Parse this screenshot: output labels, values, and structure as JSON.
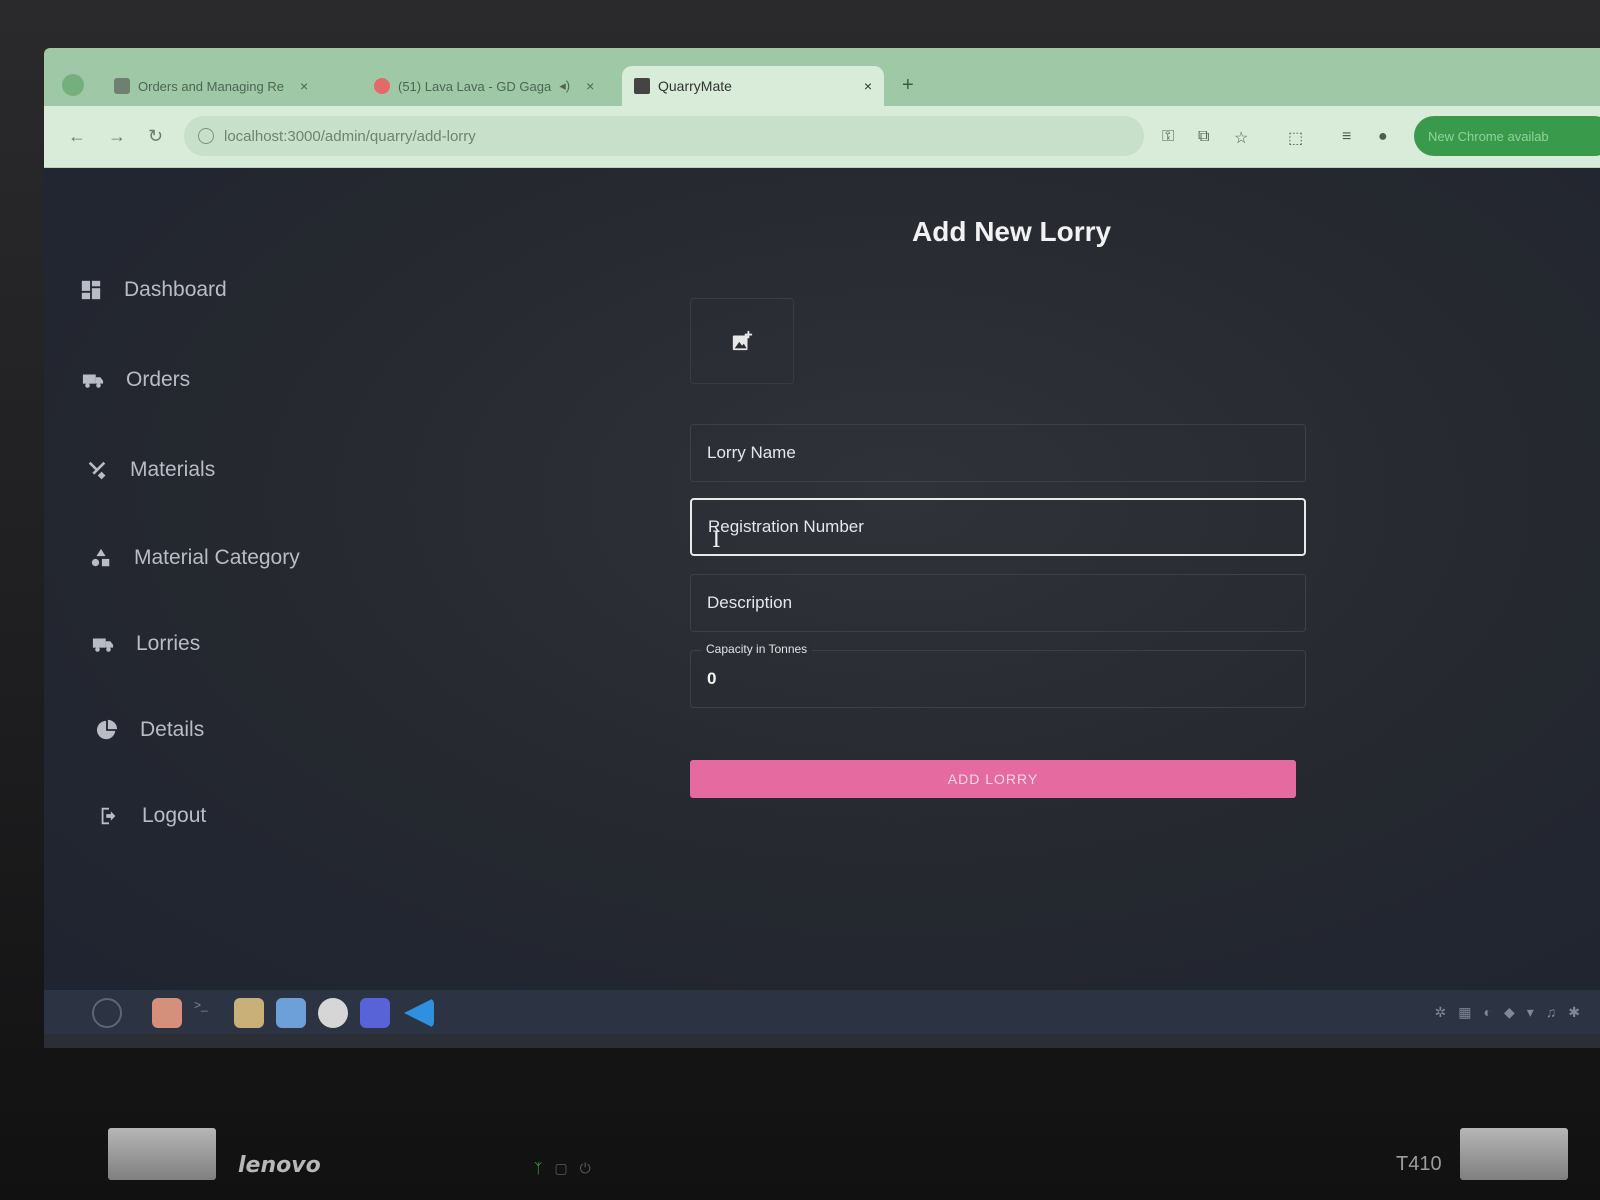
{
  "browser": {
    "tabs": [
      {
        "label": "Orders and Managing Re",
        "state": "inactive"
      },
      {
        "label": "(51) Lava Lava - GD Gaga",
        "state": "inactive"
      },
      {
        "label": "QuarryMate",
        "state": "active"
      }
    ],
    "url": "localhost:3000/admin/quarry/add-lorry",
    "update_label": "New Chrome availab"
  },
  "sidebar": {
    "items": [
      {
        "label": "Dashboard",
        "icon": "dashboard-icon"
      },
      {
        "label": "Orders",
        "icon": "truck-icon"
      },
      {
        "label": "Materials",
        "icon": "tools-icon"
      },
      {
        "label": "Material Category",
        "icon": "category-icon"
      },
      {
        "label": "Lorries",
        "icon": "truck-icon"
      },
      {
        "label": "Details",
        "icon": "pie-chart-icon"
      },
      {
        "label": "Logout",
        "icon": "logout-icon"
      }
    ]
  },
  "form": {
    "title": "Add New Lorry",
    "upload_icon": "add-photo-icon",
    "lorry_name_placeholder": "Lorry Name",
    "registration_placeholder": "Registration Number",
    "description_placeholder": "Description",
    "capacity_label": "Capacity in Tonnes",
    "capacity_value": "0",
    "submit_label": "ADD LORRY"
  },
  "colors": {
    "accent": "#e46aa0",
    "page_bg": "#2a2d34",
    "tab_strip": "#9fc8a6"
  },
  "device": {
    "brand": "lenovo",
    "model": "T410"
  }
}
